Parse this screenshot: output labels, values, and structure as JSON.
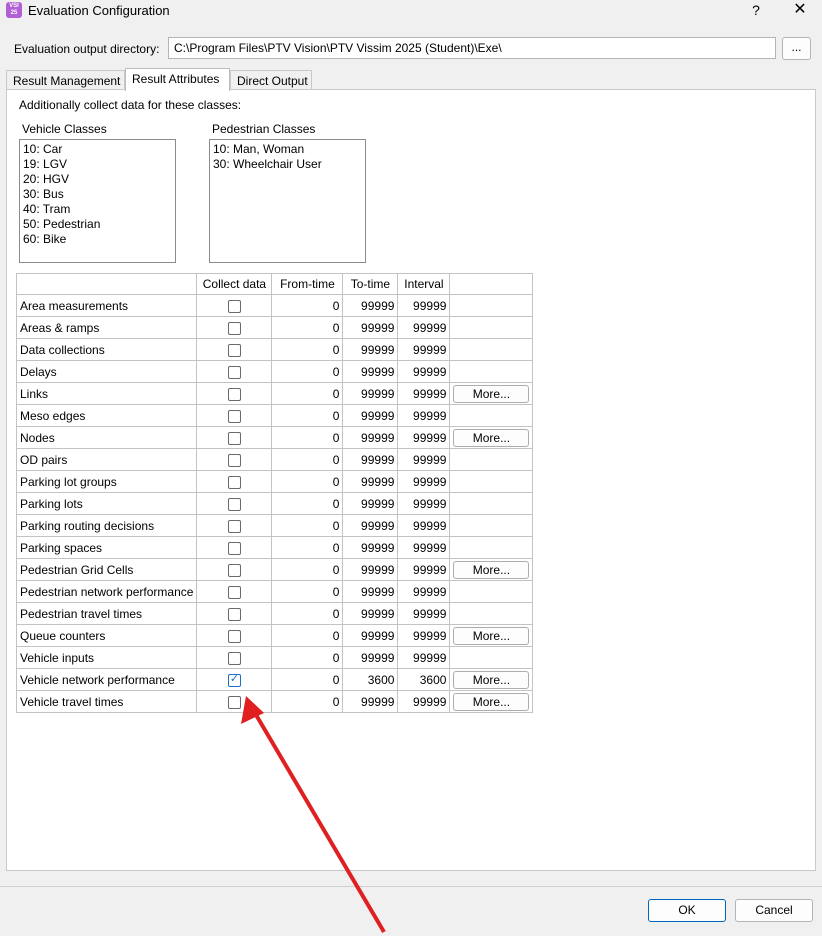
{
  "window": {
    "title": "Evaluation Configuration",
    "app_icon_text": "VSI 25",
    "help": "?",
    "close": "✕"
  },
  "output_dir": {
    "label": "Evaluation output directory:",
    "value": "C:\\Program Files\\PTV Vision\\PTV Vissim 2025 (Student)\\Exe\\",
    "browse_label": "..."
  },
  "tabs": [
    {
      "label": "Result Management",
      "active": false
    },
    {
      "label": "Result Attributes",
      "active": true
    },
    {
      "label": "Direct Output",
      "active": false
    }
  ],
  "classes": {
    "intro": "Additionally collect data for these classes:",
    "vehicle_label": "Vehicle Classes",
    "vehicle_items": [
      "10: Car",
      "19: LGV",
      "20: HGV",
      "30: Bus",
      "40: Tram",
      "50: Pedestrian",
      "60: Bike"
    ],
    "pedestrian_label": "Pedestrian Classes",
    "pedestrian_items": [
      "10: Man, Woman",
      "30: Wheelchair User"
    ]
  },
  "grid": {
    "headers": {
      "name": "",
      "collect": "Collect data",
      "from": "From-time",
      "to": "To-time",
      "interval": "Interval",
      "more": ""
    },
    "rows": [
      {
        "name": "Area measurements",
        "checked": false,
        "from": "0",
        "to": "99999",
        "interval": "99999",
        "more": ""
      },
      {
        "name": "Areas & ramps",
        "checked": false,
        "from": "0",
        "to": "99999",
        "interval": "99999",
        "more": ""
      },
      {
        "name": "Data collections",
        "checked": false,
        "from": "0",
        "to": "99999",
        "interval": "99999",
        "more": ""
      },
      {
        "name": "Delays",
        "checked": false,
        "from": "0",
        "to": "99999",
        "interval": "99999",
        "more": ""
      },
      {
        "name": "Links",
        "checked": false,
        "from": "0",
        "to": "99999",
        "interval": "99999",
        "more": "More..."
      },
      {
        "name": "Meso edges",
        "checked": false,
        "from": "0",
        "to": "99999",
        "interval": "99999",
        "more": ""
      },
      {
        "name": "Nodes",
        "checked": false,
        "from": "0",
        "to": "99999",
        "interval": "99999",
        "more": "More..."
      },
      {
        "name": "OD pairs",
        "checked": false,
        "from": "0",
        "to": "99999",
        "interval": "99999",
        "more": ""
      },
      {
        "name": "Parking lot groups",
        "checked": false,
        "from": "0",
        "to": "99999",
        "interval": "99999",
        "more": ""
      },
      {
        "name": "Parking lots",
        "checked": false,
        "from": "0",
        "to": "99999",
        "interval": "99999",
        "more": ""
      },
      {
        "name": "Parking routing decisions",
        "checked": false,
        "from": "0",
        "to": "99999",
        "interval": "99999",
        "more": ""
      },
      {
        "name": "Parking spaces",
        "checked": false,
        "from": "0",
        "to": "99999",
        "interval": "99999",
        "more": ""
      },
      {
        "name": "Pedestrian Grid Cells",
        "checked": false,
        "from": "0",
        "to": "99999",
        "interval": "99999",
        "more": "More..."
      },
      {
        "name": "Pedestrian network performance",
        "checked": false,
        "from": "0",
        "to": "99999",
        "interval": "99999",
        "more": ""
      },
      {
        "name": "Pedestrian travel times",
        "checked": false,
        "from": "0",
        "to": "99999",
        "interval": "99999",
        "more": ""
      },
      {
        "name": "Queue counters",
        "checked": false,
        "from": "0",
        "to": "99999",
        "interval": "99999",
        "more": "More..."
      },
      {
        "name": "Vehicle inputs",
        "checked": false,
        "from": "0",
        "to": "99999",
        "interval": "99999",
        "more": ""
      },
      {
        "name": "Vehicle network performance",
        "checked": true,
        "from": "0",
        "to": "3600",
        "interval": "3600",
        "more": "More..."
      },
      {
        "name": "Vehicle travel times",
        "checked": false,
        "from": "0",
        "to": "99999",
        "interval": "99999",
        "more": "More..."
      }
    ]
  },
  "footer": {
    "ok_label": "OK",
    "cancel_label": "Cancel"
  },
  "annotation": {
    "arrow_color": "#e02020"
  }
}
